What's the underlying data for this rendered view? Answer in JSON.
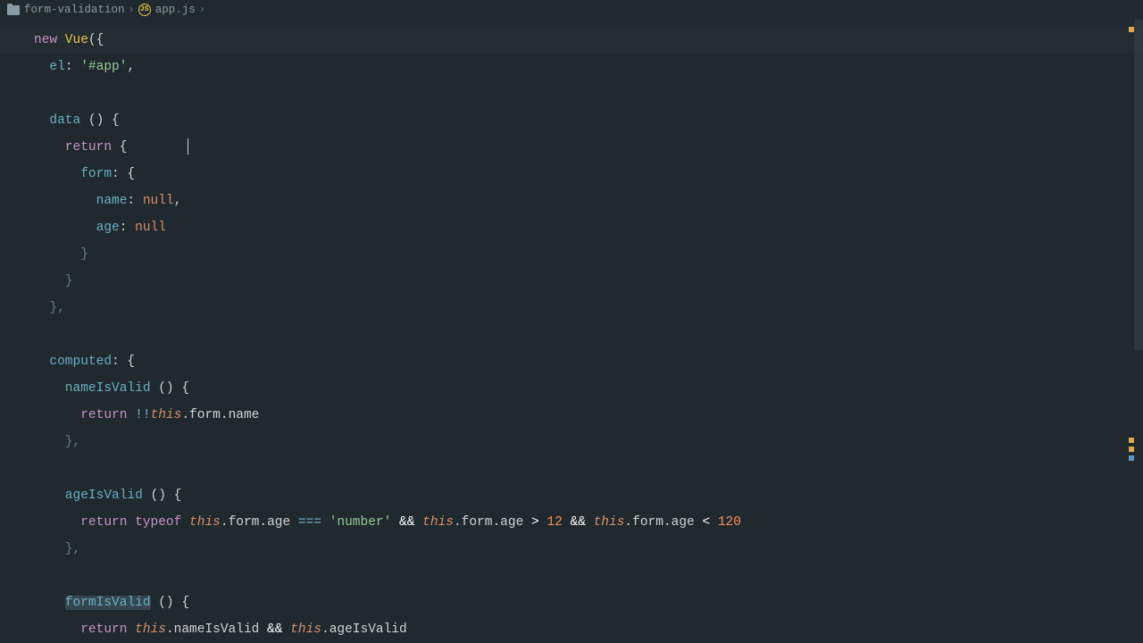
{
  "breadcrumb": {
    "folder": "form-validation",
    "file": "app.js"
  },
  "code": {
    "l1_new": "new",
    "l1_vue": " Vue",
    "l1_paren": "({",
    "l2_prop": "  el",
    "l2_colon": ": ",
    "l2_str": "'#app'",
    "l2_comma": ",",
    "l3_prop": "  data",
    "l3_paren": " () {",
    "l4_kw": "    return",
    "l4_brace": " {",
    "l5_prop": "      form",
    "l5_rest": ": {",
    "l6_prop": "        name",
    "l6_colon": ": ",
    "l6_null": "null",
    "l6_comma": ",",
    "l7_prop": "        age",
    "l7_colon": ": ",
    "l7_null": "null",
    "l8": "      }",
    "l9": "    }",
    "l10": "  },",
    "l11_prop": "  computed",
    "l11_rest": ": {",
    "l12_func": "    nameIsValid",
    "l12_rest": " () {",
    "l13_kw": "      return",
    "l13_op": " !!",
    "l13_this": "this",
    "l13_dot1": ".",
    "l13_form": "form",
    "l13_dot2": ".",
    "l13_name": "name",
    "l14": "    },",
    "l15_func": "    ageIsValid",
    "l15_rest": " () {",
    "l16_kw": "      return",
    "l16_typeof": " typeof ",
    "l16_this1": "this",
    "l16_d1": ".",
    "l16_form1": "form",
    "l16_d2": ".",
    "l16_age1": "age",
    "l16_eq": " === ",
    "l16_str": "'number'",
    "l16_and1": " && ",
    "l16_this2": "this",
    "l16_d3": ".",
    "l16_form2": "form",
    "l16_d4": ".",
    "l16_age2": "age",
    "l16_gt": " > ",
    "l16_n12": "12",
    "l16_and2": " && ",
    "l16_this3": "this",
    "l16_d5": ".",
    "l16_form3": "form",
    "l16_d6": ".",
    "l16_age3": "age",
    "l16_lt": " < ",
    "l16_n120": "120",
    "l17": "    },",
    "l18_func": "    formIsValid",
    "l18_rest": " () {",
    "l19_kw": "      return",
    "l19_sp": " ",
    "l19_this1": "this",
    "l19_d1": ".",
    "l19_niv": "nameIsValid",
    "l19_and": " && ",
    "l19_this2": "this",
    "l19_d2": ".",
    "l19_aiv": "ageIsValid"
  }
}
